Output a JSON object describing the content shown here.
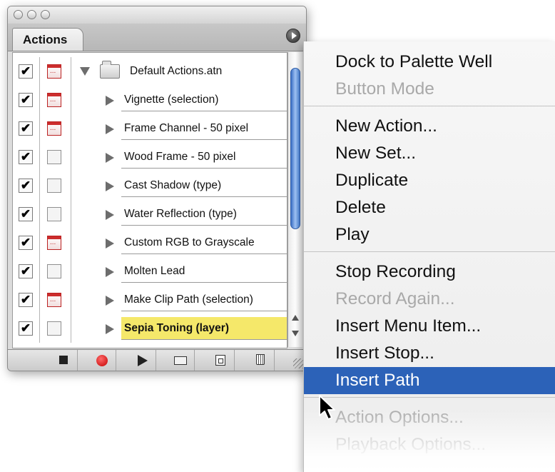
{
  "palette": {
    "tab_label": "Actions",
    "set": {
      "name": "Default Actions.atn",
      "checked": true,
      "dialog": true
    },
    "actions": [
      {
        "name": "Vignette (selection)",
        "checked": true,
        "dialog": true
      },
      {
        "name": "Frame Channel - 50 pixel",
        "checked": true,
        "dialog": true
      },
      {
        "name": "Wood Frame - 50 pixel",
        "checked": true,
        "dialog": false
      },
      {
        "name": "Cast Shadow (type)",
        "checked": true,
        "dialog": false
      },
      {
        "name": "Water Reflection (type)",
        "checked": true,
        "dialog": false
      },
      {
        "name": "Custom RGB to Grayscale",
        "checked": true,
        "dialog": true
      },
      {
        "name": "Molten Lead",
        "checked": true,
        "dialog": false
      },
      {
        "name": "Make Clip Path (selection)",
        "checked": true,
        "dialog": true
      },
      {
        "name": "Sepia Toning (layer)",
        "checked": true,
        "dialog": false,
        "selected": true
      }
    ],
    "toolbar": [
      "stop-icon",
      "record-icon",
      "play-icon",
      "new-set-icon",
      "new-action-icon",
      "trash-icon"
    ]
  },
  "menu": {
    "items": [
      {
        "label": "Dock to Palette Well",
        "enabled": true
      },
      {
        "label": "Button Mode",
        "enabled": false
      },
      {
        "label": "New Action...",
        "enabled": true
      },
      {
        "label": "New Set...",
        "enabled": true
      },
      {
        "label": "Duplicate",
        "enabled": true
      },
      {
        "label": "Delete",
        "enabled": true
      },
      {
        "label": "Play",
        "enabled": true
      },
      {
        "label": "Stop Recording",
        "enabled": true
      },
      {
        "label": "Record Again...",
        "enabled": false
      },
      {
        "label": "Insert Menu Item...",
        "enabled": true
      },
      {
        "label": "Insert Stop...",
        "enabled": true
      },
      {
        "label": "Insert Path",
        "enabled": true,
        "highlighted": true
      },
      {
        "label": "Action Options...",
        "enabled": false
      },
      {
        "label": "Playback Options...",
        "enabled": false
      }
    ]
  },
  "colors": {
    "selection_yellow": "#f5e86a",
    "menu_highlight": "#2c62b8",
    "scroll_thumb": "#4a82d6",
    "dialog_red": "#cc2d2d"
  }
}
